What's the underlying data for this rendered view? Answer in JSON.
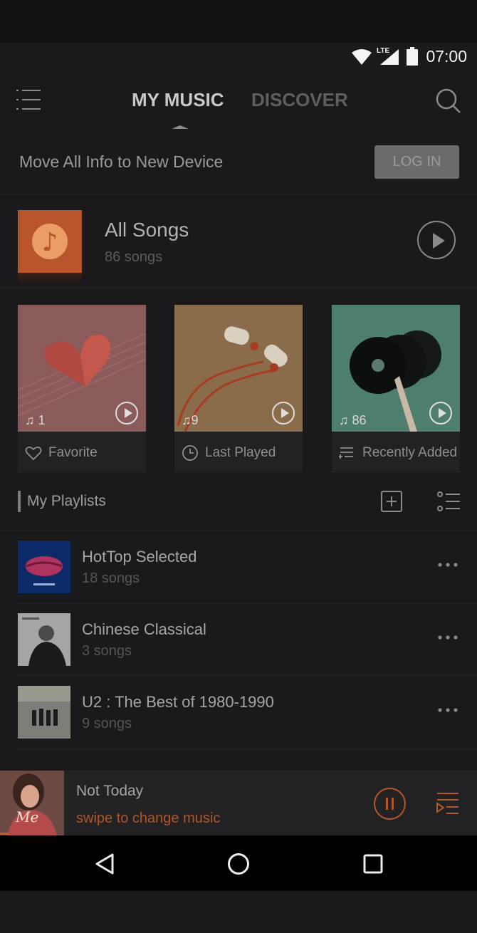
{
  "status_bar": {
    "network": "LTE",
    "time": "07:00"
  },
  "header": {
    "tabs": [
      {
        "label": "MY MUSIC",
        "active": true
      },
      {
        "label": "DISCOVER",
        "active": false
      }
    ],
    "menu_icon": "hamburger-icon",
    "search_icon": "search-icon"
  },
  "banner": {
    "text": "Move All Info to New Device",
    "button_label": "LOG IN"
  },
  "all_songs": {
    "title": "All Songs",
    "subtitle": "86 songs"
  },
  "quick_cards": [
    {
      "label": "Favorite",
      "count": "1",
      "icon": "heart-icon"
    },
    {
      "label": "Last Played",
      "count": "9",
      "icon": "clock-icon"
    },
    {
      "label": "Recently Added",
      "count": "86",
      "icon": "list-add-icon"
    }
  ],
  "playlists": {
    "title": "My Playlists",
    "items": [
      {
        "title": "HotTop Selected",
        "subtitle": "18 songs"
      },
      {
        "title": "Chinese Classical",
        "subtitle": "3 songs"
      },
      {
        "title": "U2 : The Best of 1980-1990",
        "subtitle": "9 songs"
      }
    ]
  },
  "now_playing": {
    "title": "Not Today",
    "subtitle": "swipe to change music",
    "progress": 0.02
  },
  "colors": {
    "accent": "#b3562a",
    "background": "#1a1a1c",
    "card": "#222224"
  }
}
